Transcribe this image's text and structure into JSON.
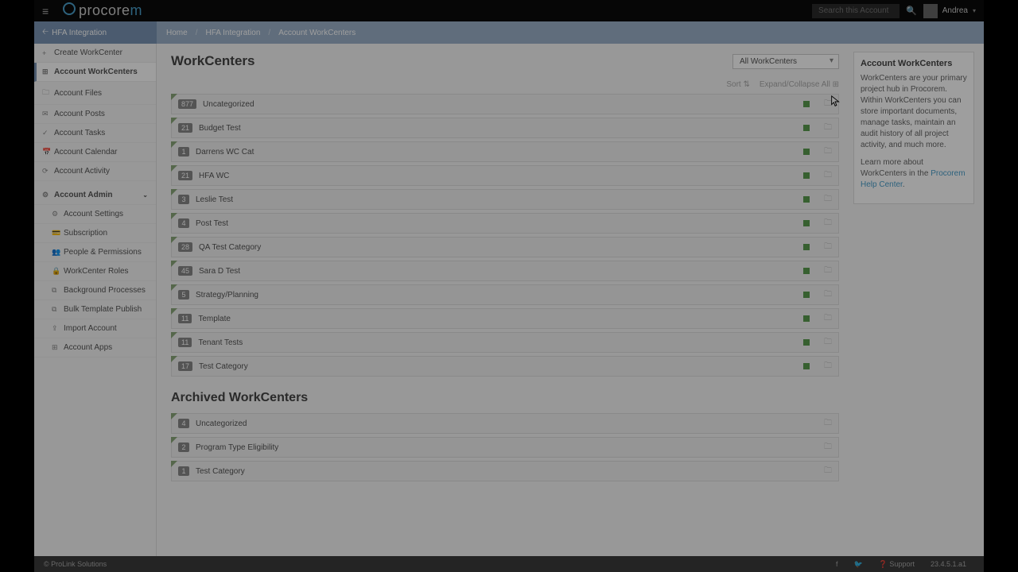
{
  "header": {
    "logo_part1": "procore",
    "logo_part2": "m",
    "search_placeholder": "Search this Account",
    "user_name": "Andrea"
  },
  "context": {
    "label": "HFA Integration"
  },
  "breadcrumb": {
    "home": "Home",
    "lvl1": "HFA Integration",
    "lvl2": "Account WorkCenters"
  },
  "sidebar": {
    "items": [
      {
        "label": "Create WorkCenter",
        "ico": "+"
      },
      {
        "label": "Account WorkCenters",
        "ico": "⊞",
        "active": true
      },
      {
        "label": "Account Files",
        "ico": "🗀"
      },
      {
        "label": "Account Posts",
        "ico": "✉"
      },
      {
        "label": "Account Tasks",
        "ico": "✓"
      },
      {
        "label": "Account Calendar",
        "ico": "📅"
      },
      {
        "label": "Account Activity",
        "ico": "⟳"
      }
    ],
    "admin_label": "Account Admin",
    "admin_items": [
      {
        "label": "Account Settings",
        "ico": "⚙"
      },
      {
        "label": "Subscription",
        "ico": "💳"
      },
      {
        "label": "People & Permissions",
        "ico": "👥"
      },
      {
        "label": "WorkCenter Roles",
        "ico": "🔒"
      },
      {
        "label": "Background Processes",
        "ico": "⧉"
      },
      {
        "label": "Bulk Template Publish",
        "ico": "⧉"
      },
      {
        "label": "Import Account",
        "ico": "⇪"
      },
      {
        "label": "Account Apps",
        "ico": "⊞"
      }
    ]
  },
  "main": {
    "title": "WorkCenters",
    "filter_label": "All WorkCenters",
    "toolbar_sort": "Sort",
    "toolbar_expand": "Expand/Collapse All",
    "workcenters": [
      {
        "count": "877",
        "name": "Uncategorized"
      },
      {
        "count": "21",
        "name": "Budget Test"
      },
      {
        "count": "1",
        "name": "Darrens WC Cat"
      },
      {
        "count": "21",
        "name": "HFA WC"
      },
      {
        "count": "3",
        "name": "Leslie Test"
      },
      {
        "count": "4",
        "name": "Post Test"
      },
      {
        "count": "28",
        "name": "QA Test Category"
      },
      {
        "count": "45",
        "name": "Sara D Test"
      },
      {
        "count": "5",
        "name": "Strategy/Planning"
      },
      {
        "count": "11",
        "name": "Template"
      },
      {
        "count": "11",
        "name": "Tenant Tests"
      },
      {
        "count": "17",
        "name": "Test Category"
      }
    ],
    "archived_title": "Archived WorkCenters",
    "archived": [
      {
        "count": "4",
        "name": "Uncategorized"
      },
      {
        "count": "2",
        "name": "Program Type Eligibility"
      },
      {
        "count": "1",
        "name": "Test Category"
      }
    ]
  },
  "info": {
    "title": "Account WorkCenters",
    "body": "WorkCenters are your primary project hub in Procorem. Within WorkCenters you can store important documents, manage tasks, maintain an audit history of all project activity, and much more.",
    "learn_prefix": "Learn more about WorkCenters in the ",
    "learn_link": "Procorem Help Center"
  },
  "footer": {
    "copyright": "© ProLink Solutions",
    "support": "Support",
    "version": "23.4.5.1.a1"
  }
}
